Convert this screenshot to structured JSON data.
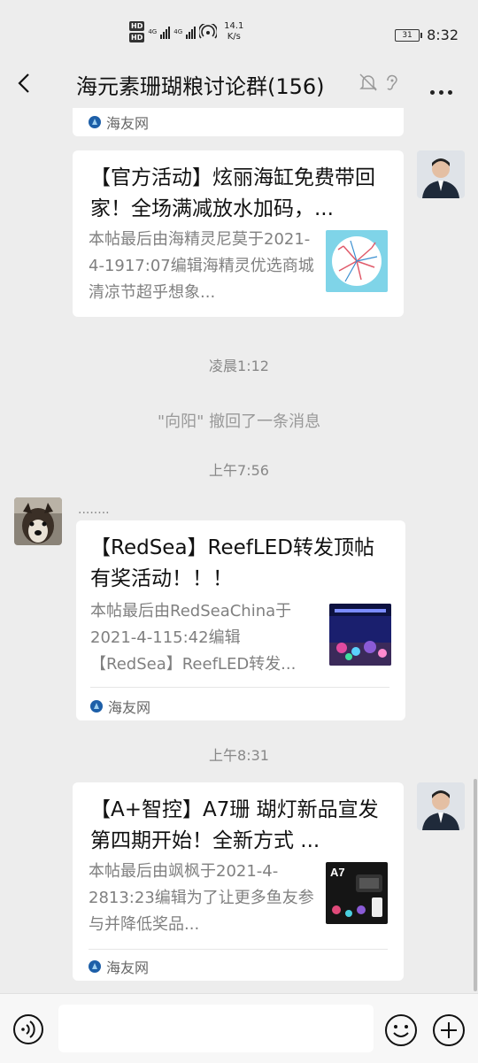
{
  "status": {
    "hd1": "HD",
    "hd2": "HD",
    "net1": "4G",
    "net2": "4G",
    "speed_value": "14.1",
    "speed_unit": "K/s",
    "battery": "31",
    "time": "8:32"
  },
  "header": {
    "title": "海元素珊瑚粮讨论群(156)"
  },
  "messages": {
    "card0": {
      "source": "海友网"
    },
    "card1": {
      "title": "【官方活动】炫丽海缸免费带回家！全场满减放水加码，...",
      "desc": "本帖最后由海精灵尼莫于2021-4-1917:07编辑海精灵优选商城清凉节超乎想象..."
    },
    "time1": "凌晨1:12",
    "recall": "\"向阳\" 撤回了一条消息",
    "time2": "上午7:56",
    "nick2": "........",
    "card2": {
      "title": "【RedSea】ReefLED转发顶帖有奖活动！！！",
      "desc": "本帖最后由RedSeaChina于2021-4-115:42编辑【RedSea】ReefLED转发...",
      "source": "海友网"
    },
    "time3": "上午8:31",
    "card3": {
      "title": "【A+智控】A7珊 瑚灯新品宣发 第四期开始！全新方式 ...",
      "desc": "本帖最后由飒枫于2021-4-2813:23编辑为了让更多鱼友参与并降低奖品...",
      "source": "海友网",
      "thumb_label": "A7"
    }
  },
  "colors": {
    "background": "#ededed",
    "source_logo": "#1d5fa8"
  }
}
